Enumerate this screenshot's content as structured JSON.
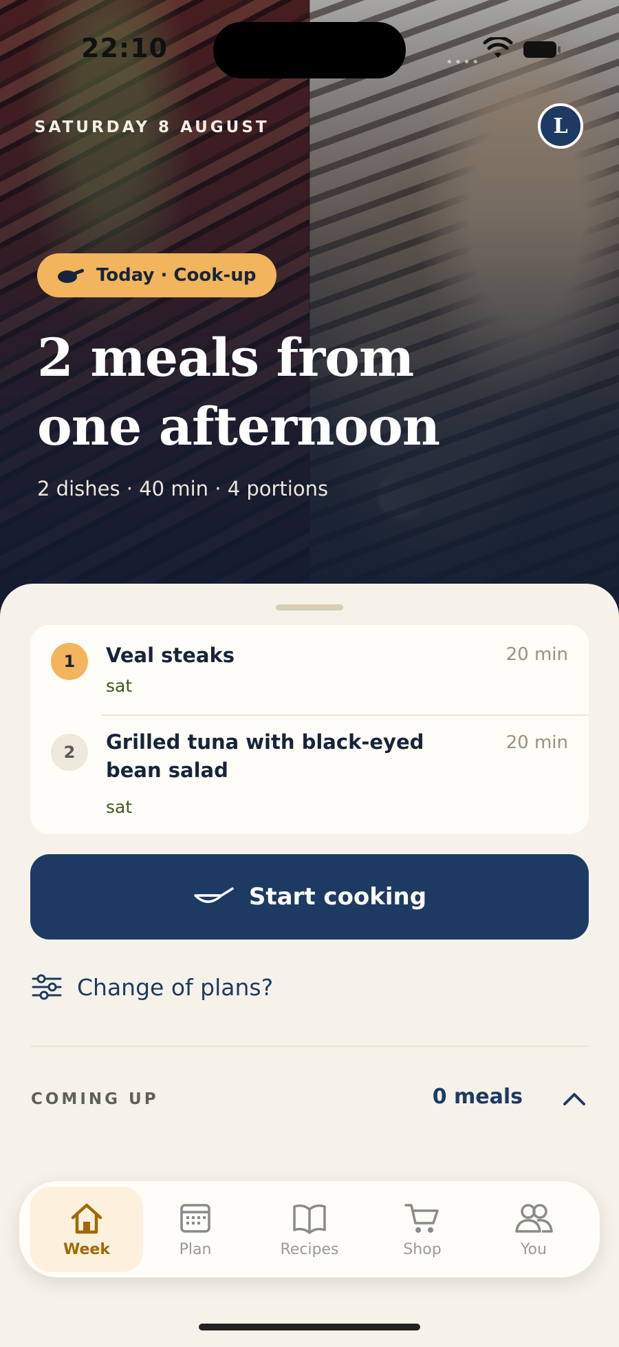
{
  "status_bar": {
    "time": "22:10"
  },
  "hero": {
    "date": "SATURDAY 8 AUGUST",
    "avatar_initial": "L",
    "pill_label": "Today · Cook-up",
    "title_line1": "2 meals from",
    "title_line2": "one afternoon",
    "meta": "2 dishes · 40 min · 4 portions"
  },
  "dishes": [
    {
      "number": "1",
      "name": "Veal steaks",
      "day": "sat",
      "duration": "20 min"
    },
    {
      "number": "2",
      "name": "Grilled tuna with black-eyed bean salad",
      "day": "sat",
      "duration": "20 min"
    }
  ],
  "cta": {
    "label": "Start cooking"
  },
  "change_plans": {
    "label": "Change of plans?"
  },
  "coming_up": {
    "label": "COMING UP",
    "count": "0 meals"
  },
  "tabs": [
    {
      "label": "Week",
      "icon": "home-icon",
      "active": true
    },
    {
      "label": "Plan",
      "icon": "calendar-icon",
      "active": false
    },
    {
      "label": "Recipes",
      "icon": "book-icon",
      "active": false
    },
    {
      "label": "Shop",
      "icon": "cart-icon",
      "active": false
    },
    {
      "label": "You",
      "icon": "people-icon",
      "active": false
    }
  ],
  "colors": {
    "navy": "#1d3a62",
    "accent": "#f2b45c",
    "background": "#f6f2e9",
    "day_green": "#3e5a1d"
  }
}
